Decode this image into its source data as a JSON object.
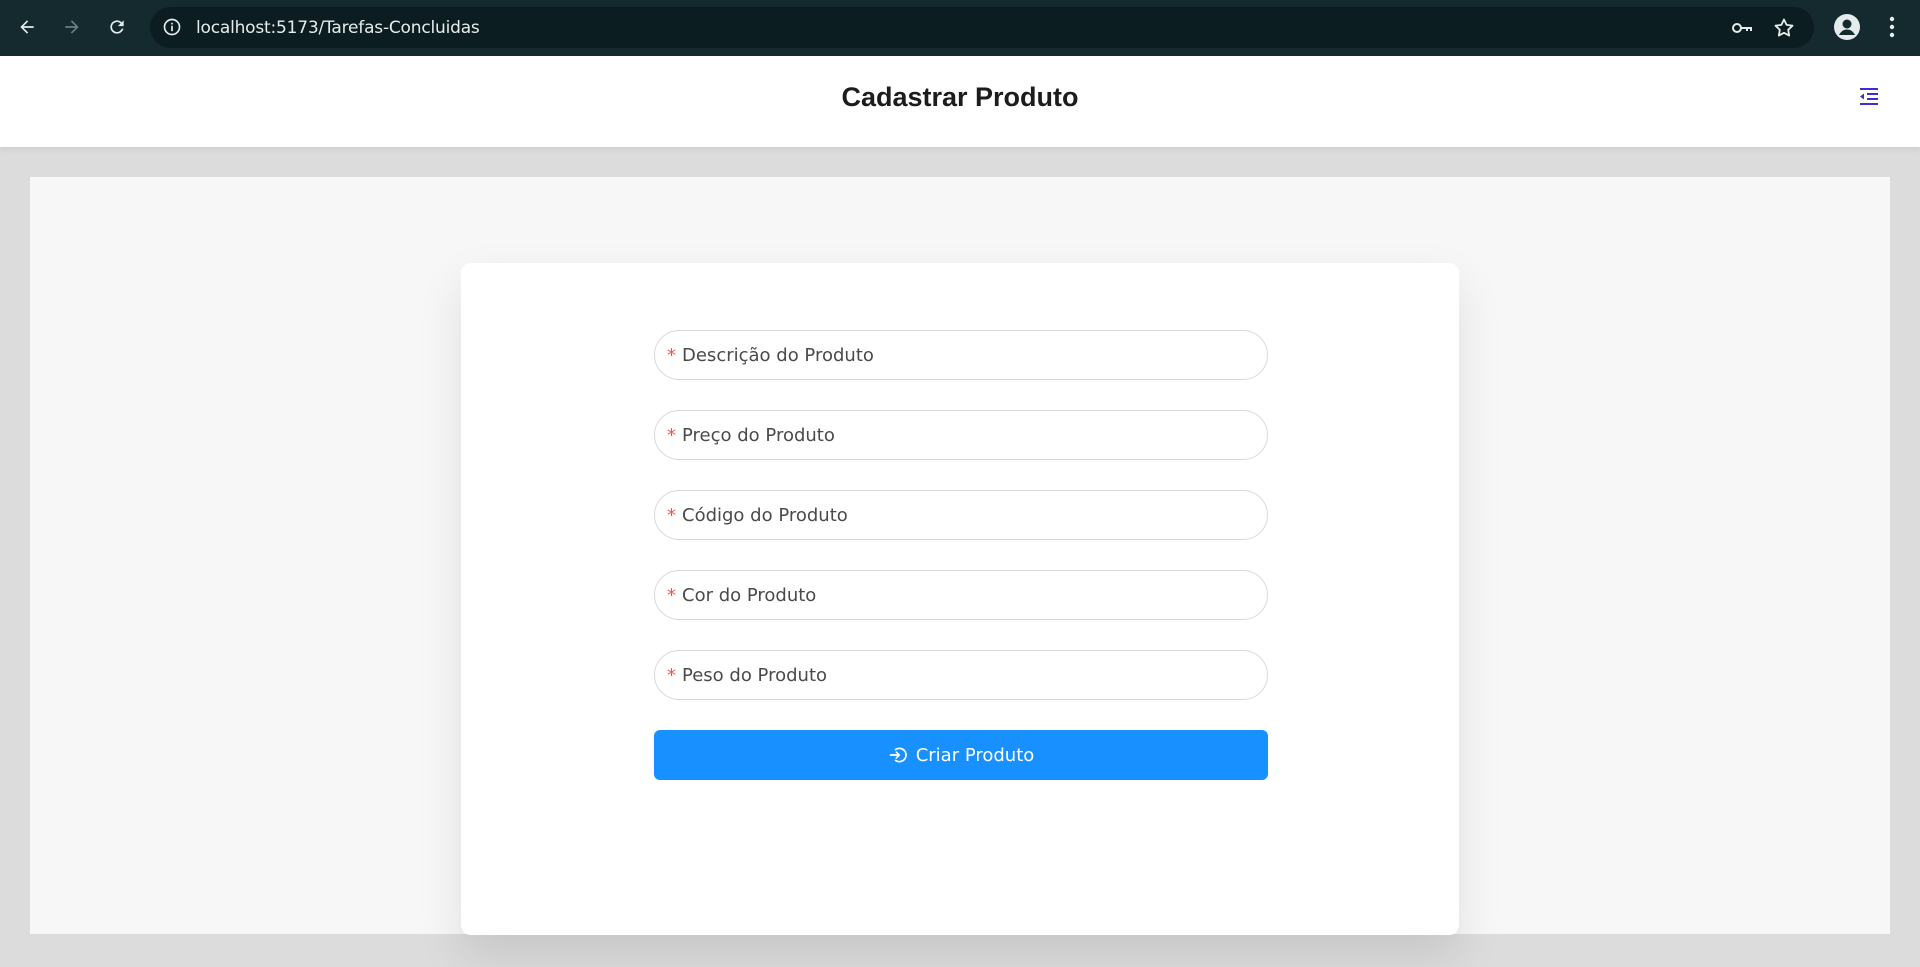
{
  "browser": {
    "url": "localhost:5173/Tarefas-Concluidas",
    "icons": [
      "back-arrow-icon",
      "forward-arrow-icon",
      "reload-icon",
      "site-info-icon",
      "password-key-icon",
      "bookmark-star-icon",
      "profile-icon",
      "more-vert-icon"
    ]
  },
  "header": {
    "title": "Cadastrar Produto",
    "menu_icon": "menu-fold-icon"
  },
  "form": {
    "required_mark": "*",
    "fields": [
      {
        "placeholder": "Descrição do Produto"
      },
      {
        "placeholder": "Preço do Produto"
      },
      {
        "placeholder": "Código do Produto"
      },
      {
        "placeholder": "Cor do Produto"
      },
      {
        "placeholder": "Peso do Produto"
      }
    ],
    "submit_label": "Criar Produto",
    "submit_icon": "login-icon"
  },
  "colors": {
    "chrome_bg": "#142a2e",
    "accent": "#1890ff",
    "required": "#ff4d4f",
    "menu_icon": "#3b2fd1"
  }
}
